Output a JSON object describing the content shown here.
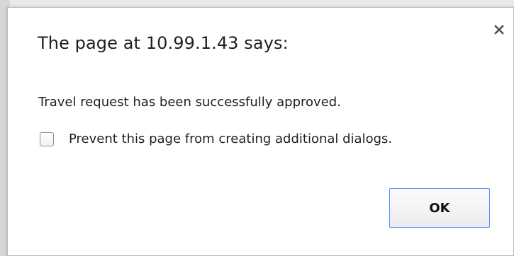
{
  "dialog": {
    "title": "The page at 10.99.1.43 says:",
    "message": "Travel request has been successfully approved.",
    "checkbox_label": "Prevent this page from creating additional dialogs.",
    "checkbox_checked": false,
    "ok_label": "OK",
    "close_icon": "close-icon"
  },
  "colors": {
    "button_border": "#4d90fe",
    "text": "#1f1f1f",
    "dialog_bg": "#ffffff"
  }
}
